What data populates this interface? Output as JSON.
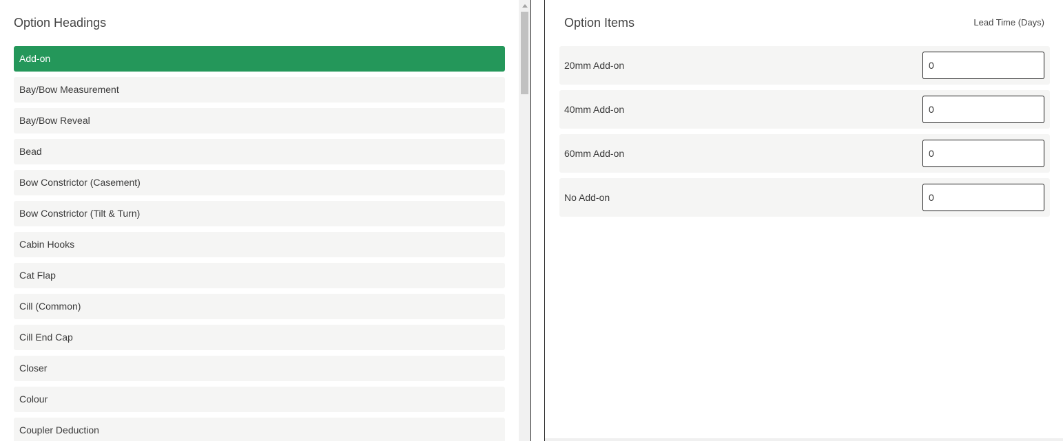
{
  "left": {
    "title": "Option Headings",
    "headings": [
      "Add-on",
      "Bay/Bow Measurement",
      "Bay/Bow Reveal",
      "Bead",
      "Bow Constrictor (Casement)",
      "Bow Constrictor (Tilt & Turn)",
      "Cabin Hooks",
      "Cat Flap",
      "Cill (Common)",
      "Cill End Cap",
      "Closer",
      "Colour",
      "Coupler Deduction"
    ],
    "selected_index": 0,
    "accent_color": "#24975a"
  },
  "right": {
    "title": "Option Items",
    "lead_time_header": "Lead Time (Days)",
    "items": [
      {
        "label": "20mm Add-on",
        "lead_time": "0"
      },
      {
        "label": "40mm Add-on",
        "lead_time": "0"
      },
      {
        "label": "60mm Add-on",
        "lead_time": "0"
      },
      {
        "label": "No Add-on",
        "lead_time": "0"
      }
    ]
  }
}
